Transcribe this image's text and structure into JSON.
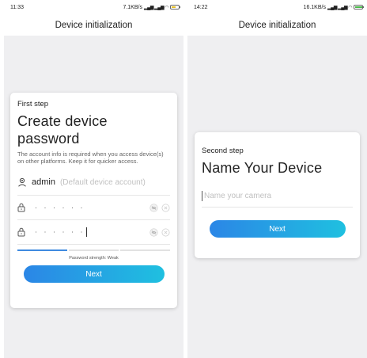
{
  "left": {
    "status": {
      "time": "11:33",
      "speed": "7.1KB/s"
    },
    "header": {
      "title": "Device initialization"
    },
    "card": {
      "step": "First step",
      "title": "Create device password",
      "description": "The account info is required when you access device(s) on other platforms. Keep it for quicker access.",
      "username": "admin",
      "username_hint": "(Default device account)",
      "password_mask": "· · · · · ·",
      "confirm_mask": "· · · · · ·",
      "strength_text": "Password strength: Weak",
      "next_label": "Next"
    }
  },
  "right": {
    "status": {
      "time": "14:22",
      "speed": "16.1KB/s"
    },
    "header": {
      "title": "Device initialization"
    },
    "card": {
      "step": "Second step",
      "title": "Name Your Device",
      "name_placeholder": "Name your camera",
      "next_label": "Next"
    }
  },
  "colors": {
    "accent_start": "#2b86e6",
    "accent_end": "#1fc0e0",
    "strength_weak": "#3f8ae0"
  },
  "password_strength_level": 1
}
